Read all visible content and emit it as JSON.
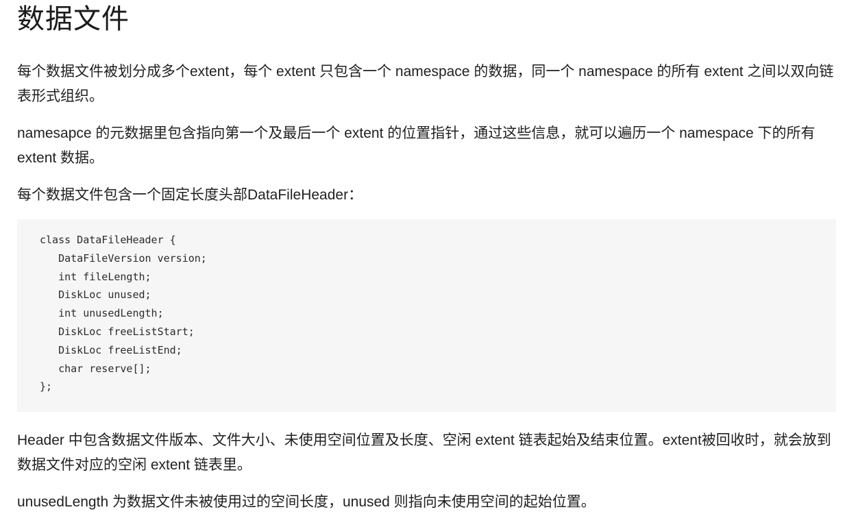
{
  "title": "数据文件",
  "paragraphs": {
    "p1": "每个数据文件被划分成多个extent，每个 extent 只包含一个 namespace 的数据，同一个 namespace 的所有 extent 之间以双向链表形式组织。",
    "p2": "namesapce 的元数据里包含指向第一个及最后一个 extent 的位置指针，通过这些信息，就可以遍历一个 namespace 下的所有 extent 数据。",
    "p3": "每个数据文件包含一个固定长度头部DataFileHeader：",
    "p4": "Header 中包含数据文件版本、文件大小、未使用空间位置及长度、空闲 extent 链表起始及结束位置。extent被回收时，就会放到数据文件对应的空闲 extent 链表里。",
    "p5": "unusedLength 为数据文件未被使用过的空间长度，unused 则指向未使用空间的起始位置。"
  },
  "code": {
    "lines": [
      "class DataFileHeader {",
      "   DataFileVersion version;",
      "   int fileLength;",
      "   DiskLoc unused;",
      "   int unusedLength;",
      "   DiskLoc freeListStart;",
      "   DiskLoc freeListEnd;",
      "   char reserve[];",
      "};"
    ]
  }
}
